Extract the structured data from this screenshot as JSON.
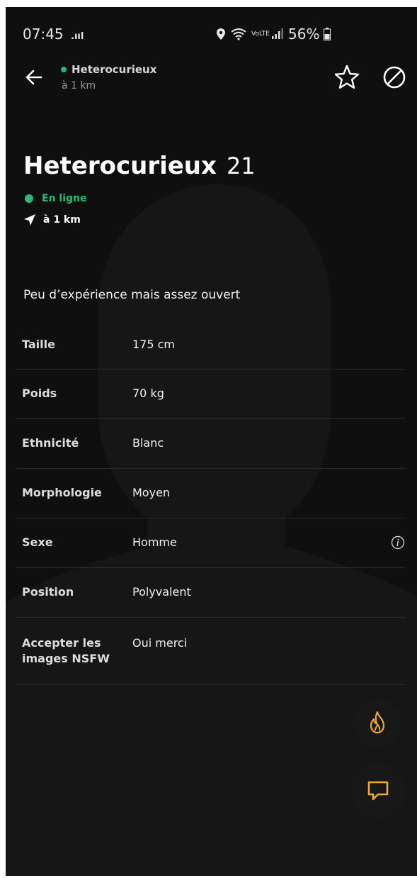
{
  "status_bar": {
    "time": "07:45",
    "battery": "56%",
    "network": "VoLTE"
  },
  "header": {
    "name": "Heterocurieux",
    "distance": "à 1 km"
  },
  "profile": {
    "name": "Heterocurieux",
    "age": "21",
    "online": "En ligne",
    "distance": "à 1 km",
    "bio": "Peu d’expérience mais assez ouvert"
  },
  "details": [
    {
      "label": "Taille",
      "value": "175 cm"
    },
    {
      "label": "Poids",
      "value": "70 kg"
    },
    {
      "label": "Ethnicité",
      "value": "Blanc"
    },
    {
      "label": "Morphologie",
      "value": "Moyen"
    },
    {
      "label": "Sexe",
      "value": "Homme"
    },
    {
      "label": "Position",
      "value": "Polyvalent"
    },
    {
      "label": "Accepter les images NSFW",
      "value": "Oui merci"
    }
  ],
  "colors": {
    "background": "#0f0f0f",
    "online": "#2eb872",
    "accent": "#f0a830"
  },
  "icons": {
    "back": "arrow-left-icon",
    "favorite": "star-icon",
    "block": "block-icon",
    "tap": "flame-icon",
    "chat": "chat-icon",
    "info": "info-icon"
  }
}
